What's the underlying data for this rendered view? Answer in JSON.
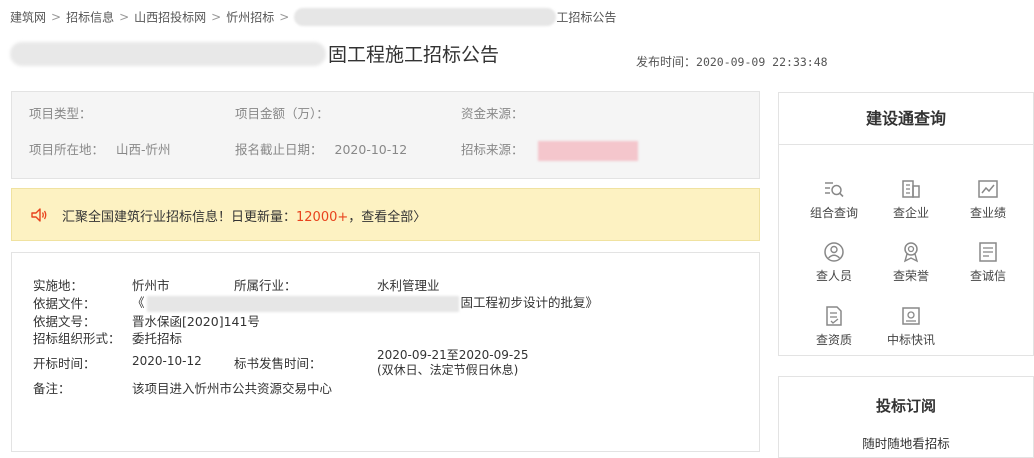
{
  "breadcrumb": {
    "items": [
      "建筑网",
      "招标信息",
      "山西招投标网",
      "忻州招标"
    ],
    "separator": ">",
    "tail": "工招标公告"
  },
  "header": {
    "title_suffix": "固工程施工招标公告",
    "publish_label": "发布时间：",
    "publish_value": "2020-09-09 22:33:48"
  },
  "info": {
    "project_type_label": "项目类型：",
    "amount_label": "项目金额（万）：",
    "fund_source_label": "资金来源：",
    "location_label": "项目所在地：",
    "location_value": "山西-忻州",
    "deadline_label": "报名截止日期：",
    "deadline_value": "2020-10-12",
    "bid_source_label": "招标来源："
  },
  "notice": {
    "text_before": "汇聚全国建筑行业招标信息！日更新量：",
    "highlight": "12000+",
    "text_after": "，查看全部〉"
  },
  "detail": {
    "impl_label": "实施地：",
    "impl_value": "忻州市",
    "industry_label": "所属行业：",
    "industry_value": "水利管理业",
    "file_label": "依据文件：",
    "file_prefix": "《",
    "file_suffix": "固工程初步设计的批复》",
    "doc_no_label": "依据文号：",
    "doc_no_value": "晋水保函[2020]141号",
    "org_form_label": "招标组织形式：",
    "org_form_value": "委托招标",
    "open_label": "开标时间：",
    "open_value": "2020-10-12",
    "sale_label": "标书发售时间：",
    "sale_value_1": "2020-09-21至2020-09-25",
    "sale_value_2": "(双休日、法定节假日休息)",
    "remark_label": "备注：",
    "remark_value": "该项目进入忻州市公共资源交易中心"
  },
  "sidebar": {
    "title": "建设通查询",
    "items": [
      {
        "label": "组合查询",
        "icon": "combined-search-icon"
      },
      {
        "label": "查企业",
        "icon": "company-icon"
      },
      {
        "label": "查业绩",
        "icon": "performance-chart-icon"
      },
      {
        "label": "查人员",
        "icon": "person-icon"
      },
      {
        "label": "查荣誉",
        "icon": "award-icon"
      },
      {
        "label": "查诚信",
        "icon": "credit-doc-icon"
      },
      {
        "label": "查资质",
        "icon": "qualification-icon"
      },
      {
        "label": "中标快讯",
        "icon": "bid-news-icon"
      }
    ]
  },
  "sidebar2": {
    "title": "投标订阅",
    "subtitle": "随时随地看招标"
  },
  "colors": {
    "highlight": "#e8431d",
    "notice_bg": "#fdf2c2",
    "info_bg": "#f5f5f5",
    "icon_gray": "#888888"
  }
}
